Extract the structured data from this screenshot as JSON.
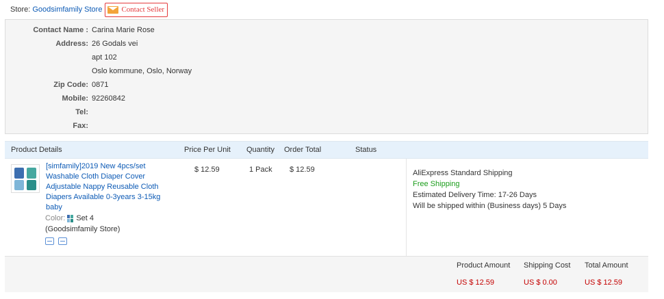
{
  "store": {
    "label": "Store:",
    "name": "Goodsimfamily Store",
    "contact_label": "Contact Seller"
  },
  "address": {
    "contact_name_key": "Contact Name :",
    "contact_name": "Carina Marie Rose",
    "address_key": "Address:",
    "address_line1": "26 Godals vei",
    "address_line2": "apt 102",
    "address_line3": "Oslo kommune, Oslo, Norway",
    "zip_key": "Zip Code:",
    "zip": "0871",
    "mobile_key": "Mobile:",
    "mobile": "92260842",
    "tel_key": "Tel:",
    "tel": "",
    "fax_key": "Fax:",
    "fax": ""
  },
  "table": {
    "headers": {
      "product": "Product Details",
      "price": "Price Per Unit",
      "quantity": "Quantity",
      "total": "Order Total",
      "status": "Status"
    },
    "item": {
      "title": "[simfamily]2019 New 4pcs/set Washable Cloth Diaper Cover Adjustable Nappy Reusable Cloth Diapers Available 0-3years 3-15kg baby",
      "color_label": "Color:",
      "color_value": "Set 4",
      "store": "(Goodsimfamily Store)",
      "price": "$ 12.59",
      "quantity": "1 Pack",
      "order_total": "$ 12.59",
      "status": ""
    },
    "shipping": {
      "method": "AliExpress Standard Shipping",
      "free": "Free Shipping",
      "estimated": "Estimated Delivery Time:  17-26 Days",
      "ship_within": "Will be shipped within (Business days)  5 Days"
    },
    "summary": {
      "product_amount_label": "Product Amount",
      "shipping_cost_label": "Shipping Cost",
      "total_amount_label": "Total Amount",
      "product_amount": "US $ 12.59",
      "shipping_cost": "US $ 0.00",
      "total_amount": "US $ 12.59"
    }
  },
  "colors": {
    "link": "#0c5ab5",
    "accent_red": "#e4393c",
    "price_red": "#c40000",
    "free_green": "#1b9d1b",
    "header_bg": "#e6f1fb"
  }
}
